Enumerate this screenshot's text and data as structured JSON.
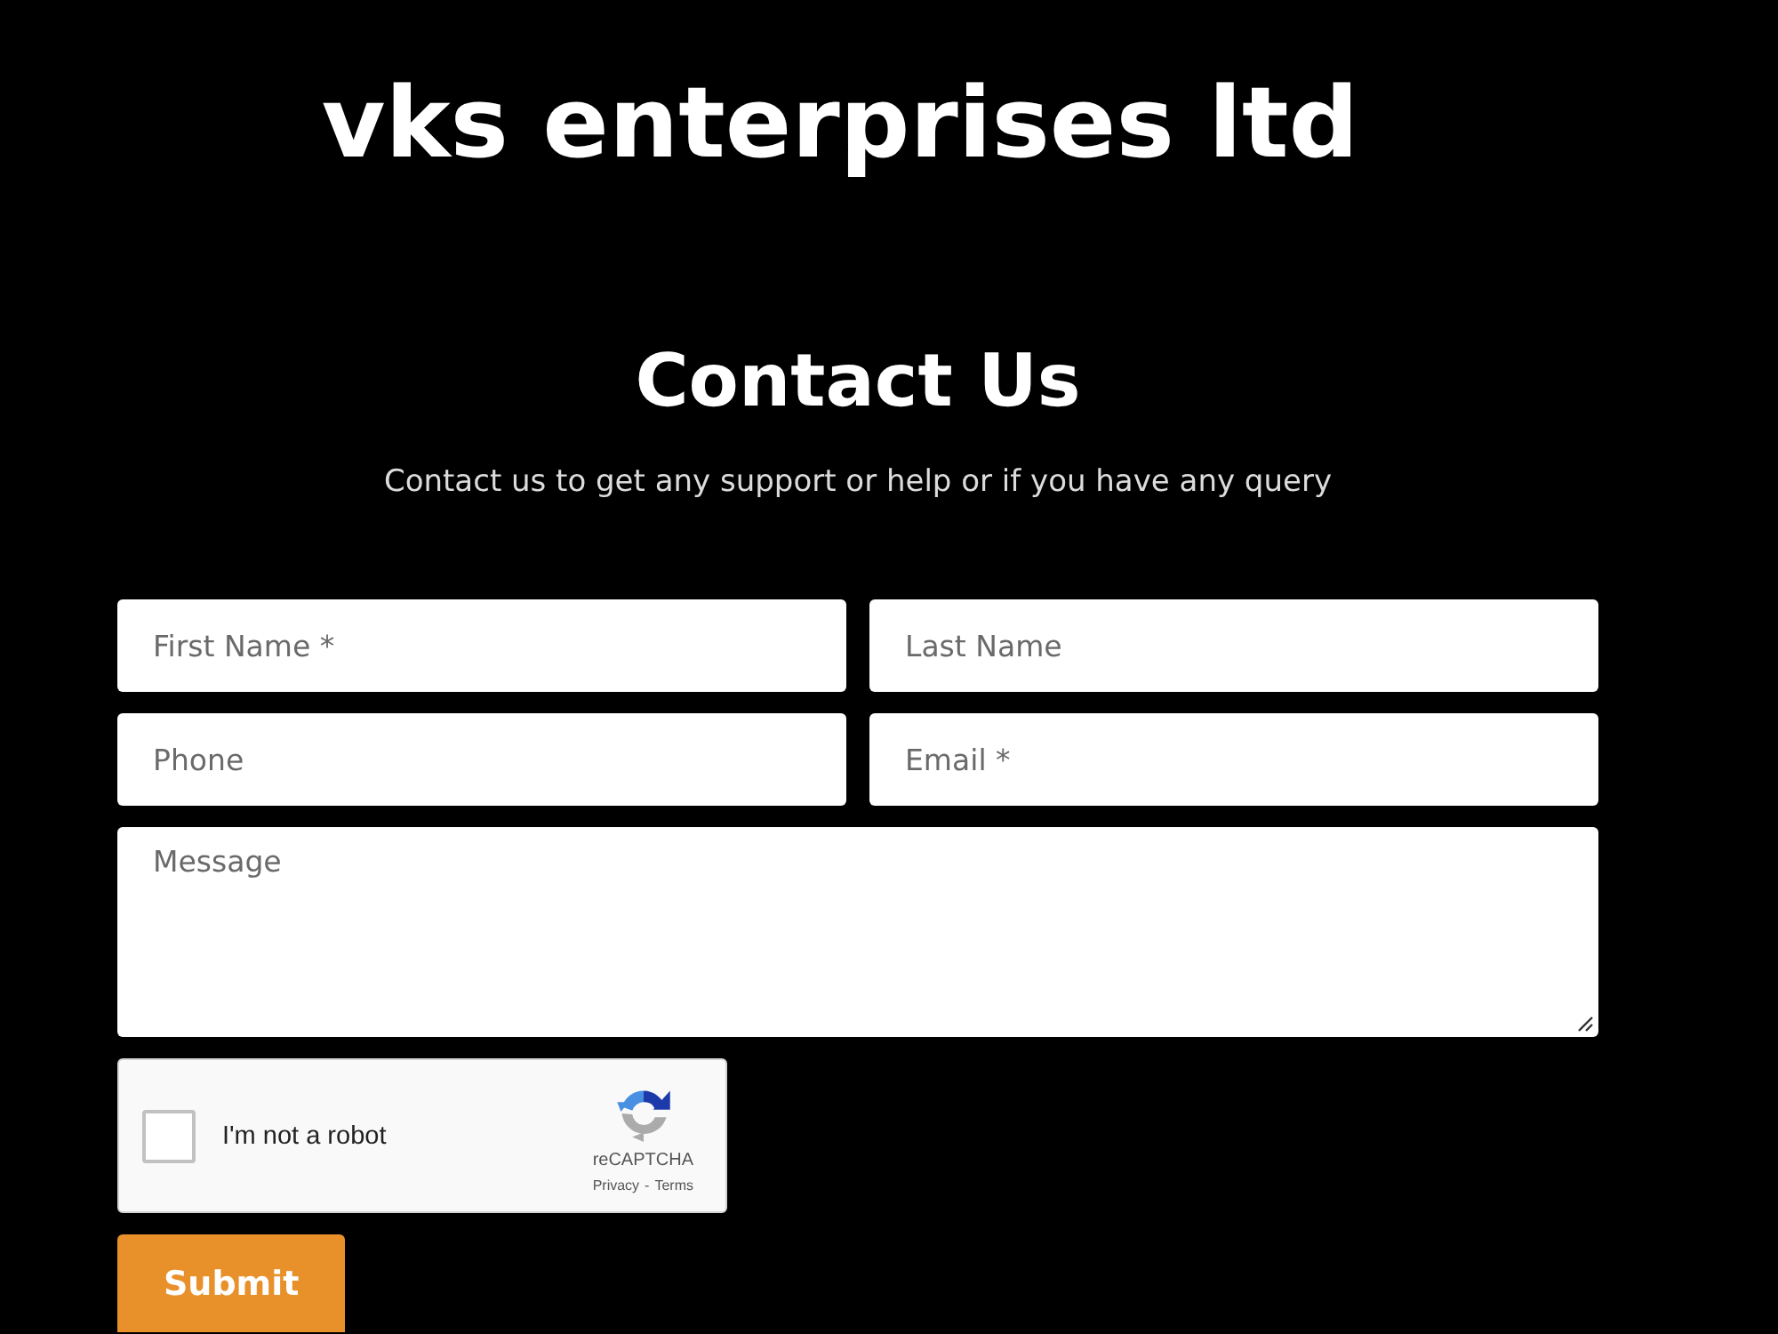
{
  "header": {
    "title": "vks enterprises ltd"
  },
  "contact": {
    "heading": "Contact Us",
    "subtitle": "Contact us to get any support or help or if you have any query"
  },
  "form": {
    "fields": [
      {
        "kind": "input",
        "placeholder": "First Name *"
      },
      {
        "kind": "input",
        "placeholder": "Last Name"
      },
      {
        "kind": "input",
        "placeholder": "Phone"
      },
      {
        "kind": "input",
        "placeholder": "Email *"
      },
      {
        "kind": "textarea",
        "placeholder": "Message"
      }
    ],
    "captcha": {
      "label": "I'm not a robot",
      "checked": false,
      "brand": "reCAPTCHA",
      "links": [
        "Privacy",
        "Terms"
      ],
      "separator": "-"
    },
    "submit": {
      "label": "Submit"
    }
  }
}
